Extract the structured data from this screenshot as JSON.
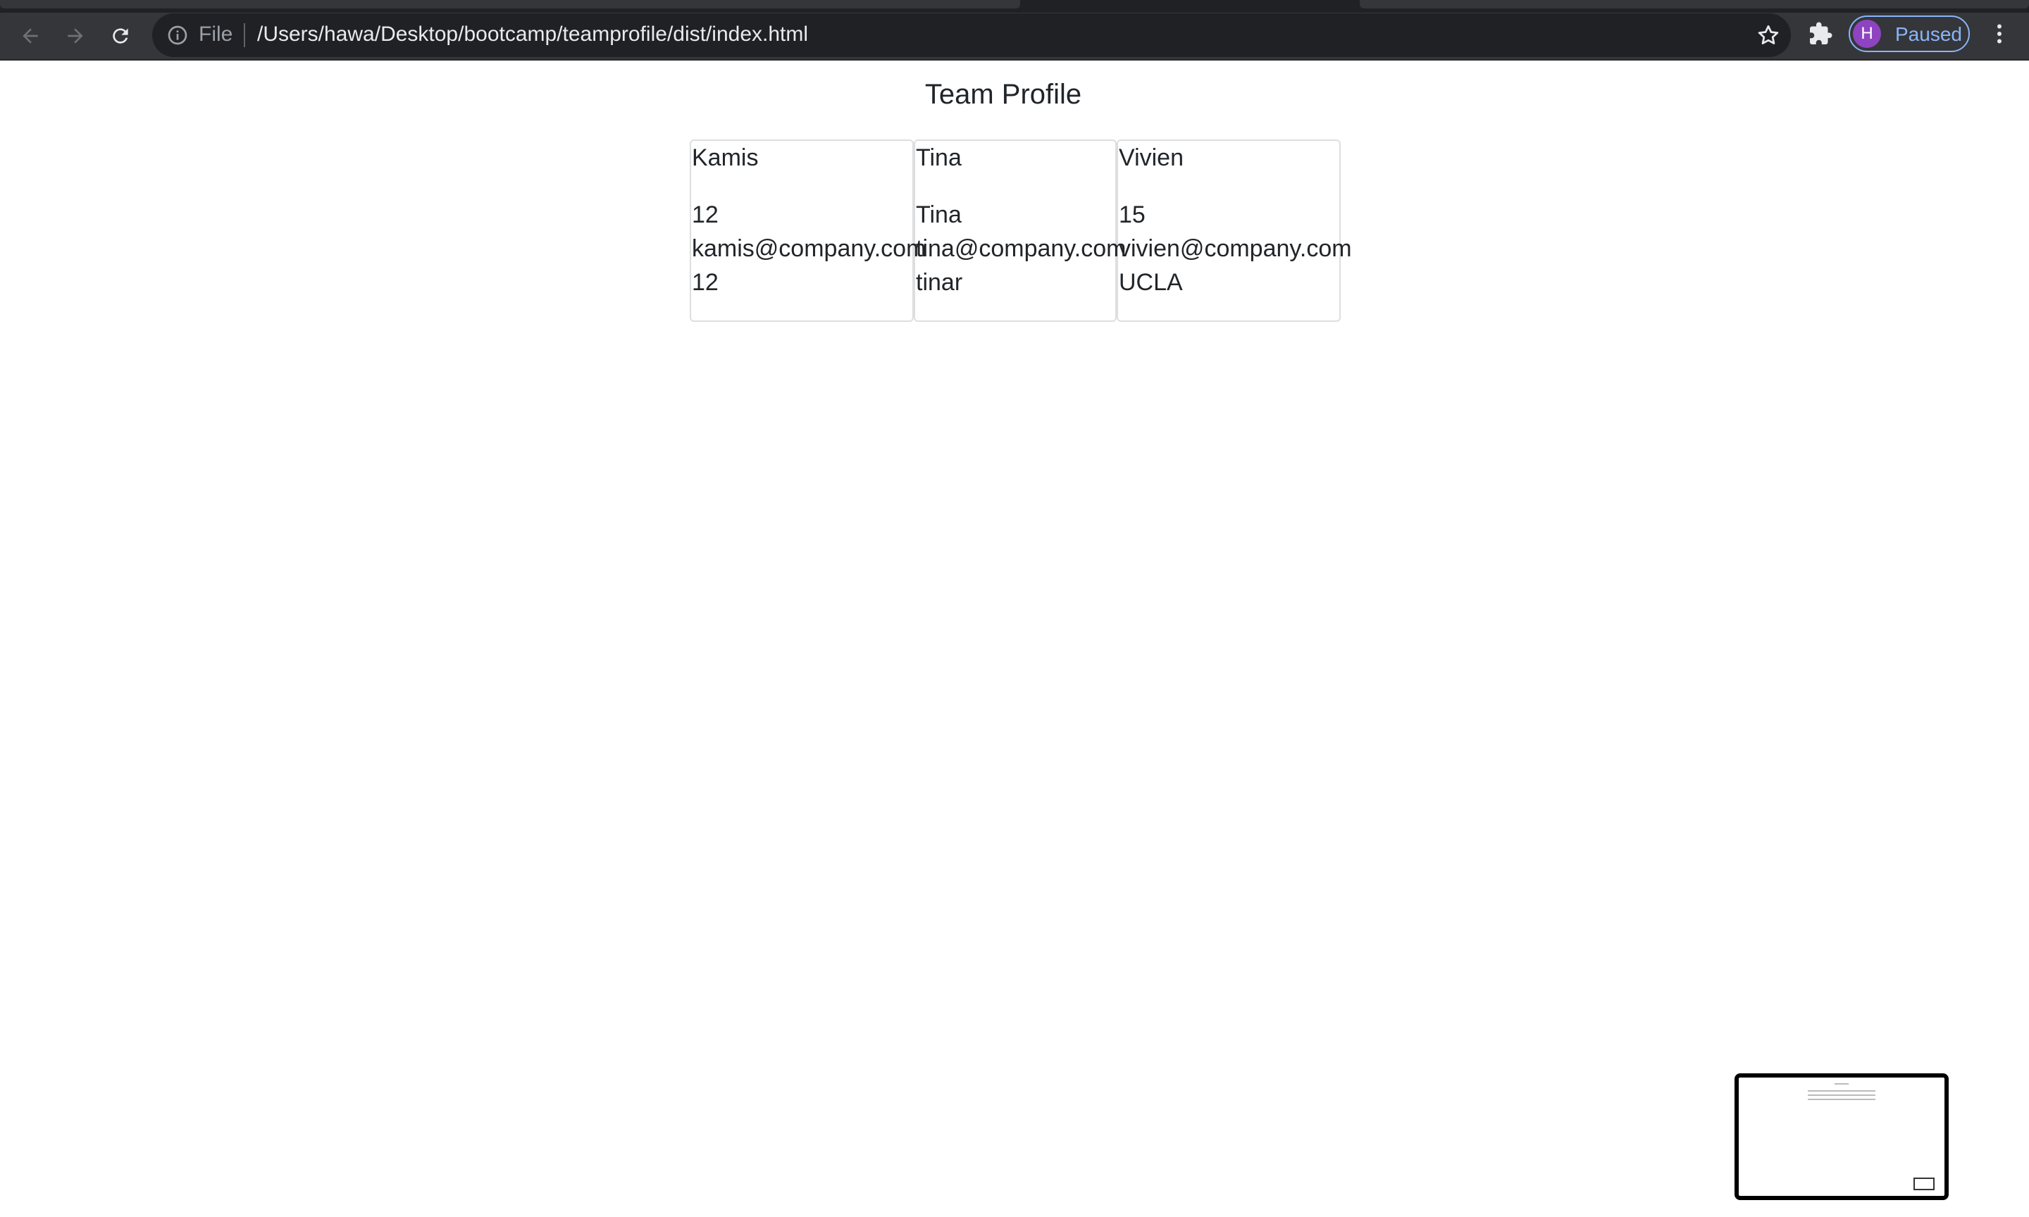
{
  "browser": {
    "scheme_label": "File",
    "url": "/Users/hawa/Desktop/bootcamp/teamprofile/dist/index.html",
    "profile_initial": "H",
    "profile_status": "Paused",
    "colors": {
      "toolbar": "#35363a",
      "omnibox": "#202124",
      "accent": "#8ab4f8",
      "avatar": "#8e44c0"
    }
  },
  "page": {
    "title": "Team Profile",
    "cards": [
      {
        "name": "Kamis",
        "line1": "12",
        "line2": "kamis@company.com",
        "line3": "12"
      },
      {
        "name": "Tina",
        "line1": "Tina",
        "line2": "tina@company.com",
        "line3": "tinar"
      },
      {
        "name": "Vivien",
        "line1": "15",
        "line2": "vivien@company.com",
        "line3": "UCLA"
      }
    ]
  }
}
